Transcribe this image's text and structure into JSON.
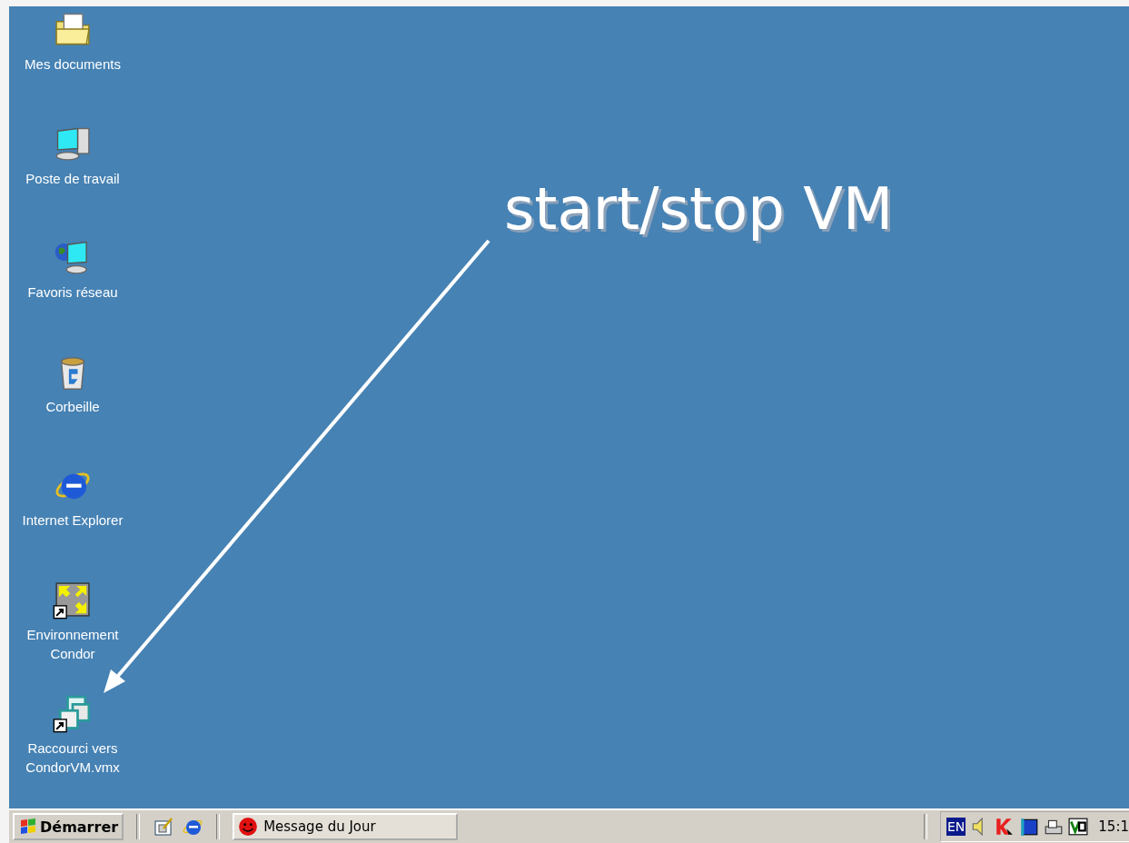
{
  "desktop": {
    "icons": [
      {
        "label": "Mes documents",
        "shortcut": false
      },
      {
        "label": "Poste de travail",
        "shortcut": false
      },
      {
        "label": "Favoris réseau",
        "shortcut": false
      },
      {
        "label": "Corbeille",
        "shortcut": false
      },
      {
        "label": "Internet Explorer",
        "shortcut": false
      },
      {
        "label": "Environnement Condor",
        "shortcut": true
      },
      {
        "label": "Raccourci vers CondorVM.vmx",
        "shortcut": true
      }
    ],
    "annotation": "start/stop VM"
  },
  "taskbar": {
    "start_button": "Démarrer",
    "task_button": "Message du Jour",
    "language": "EN",
    "clock": "15:1"
  }
}
